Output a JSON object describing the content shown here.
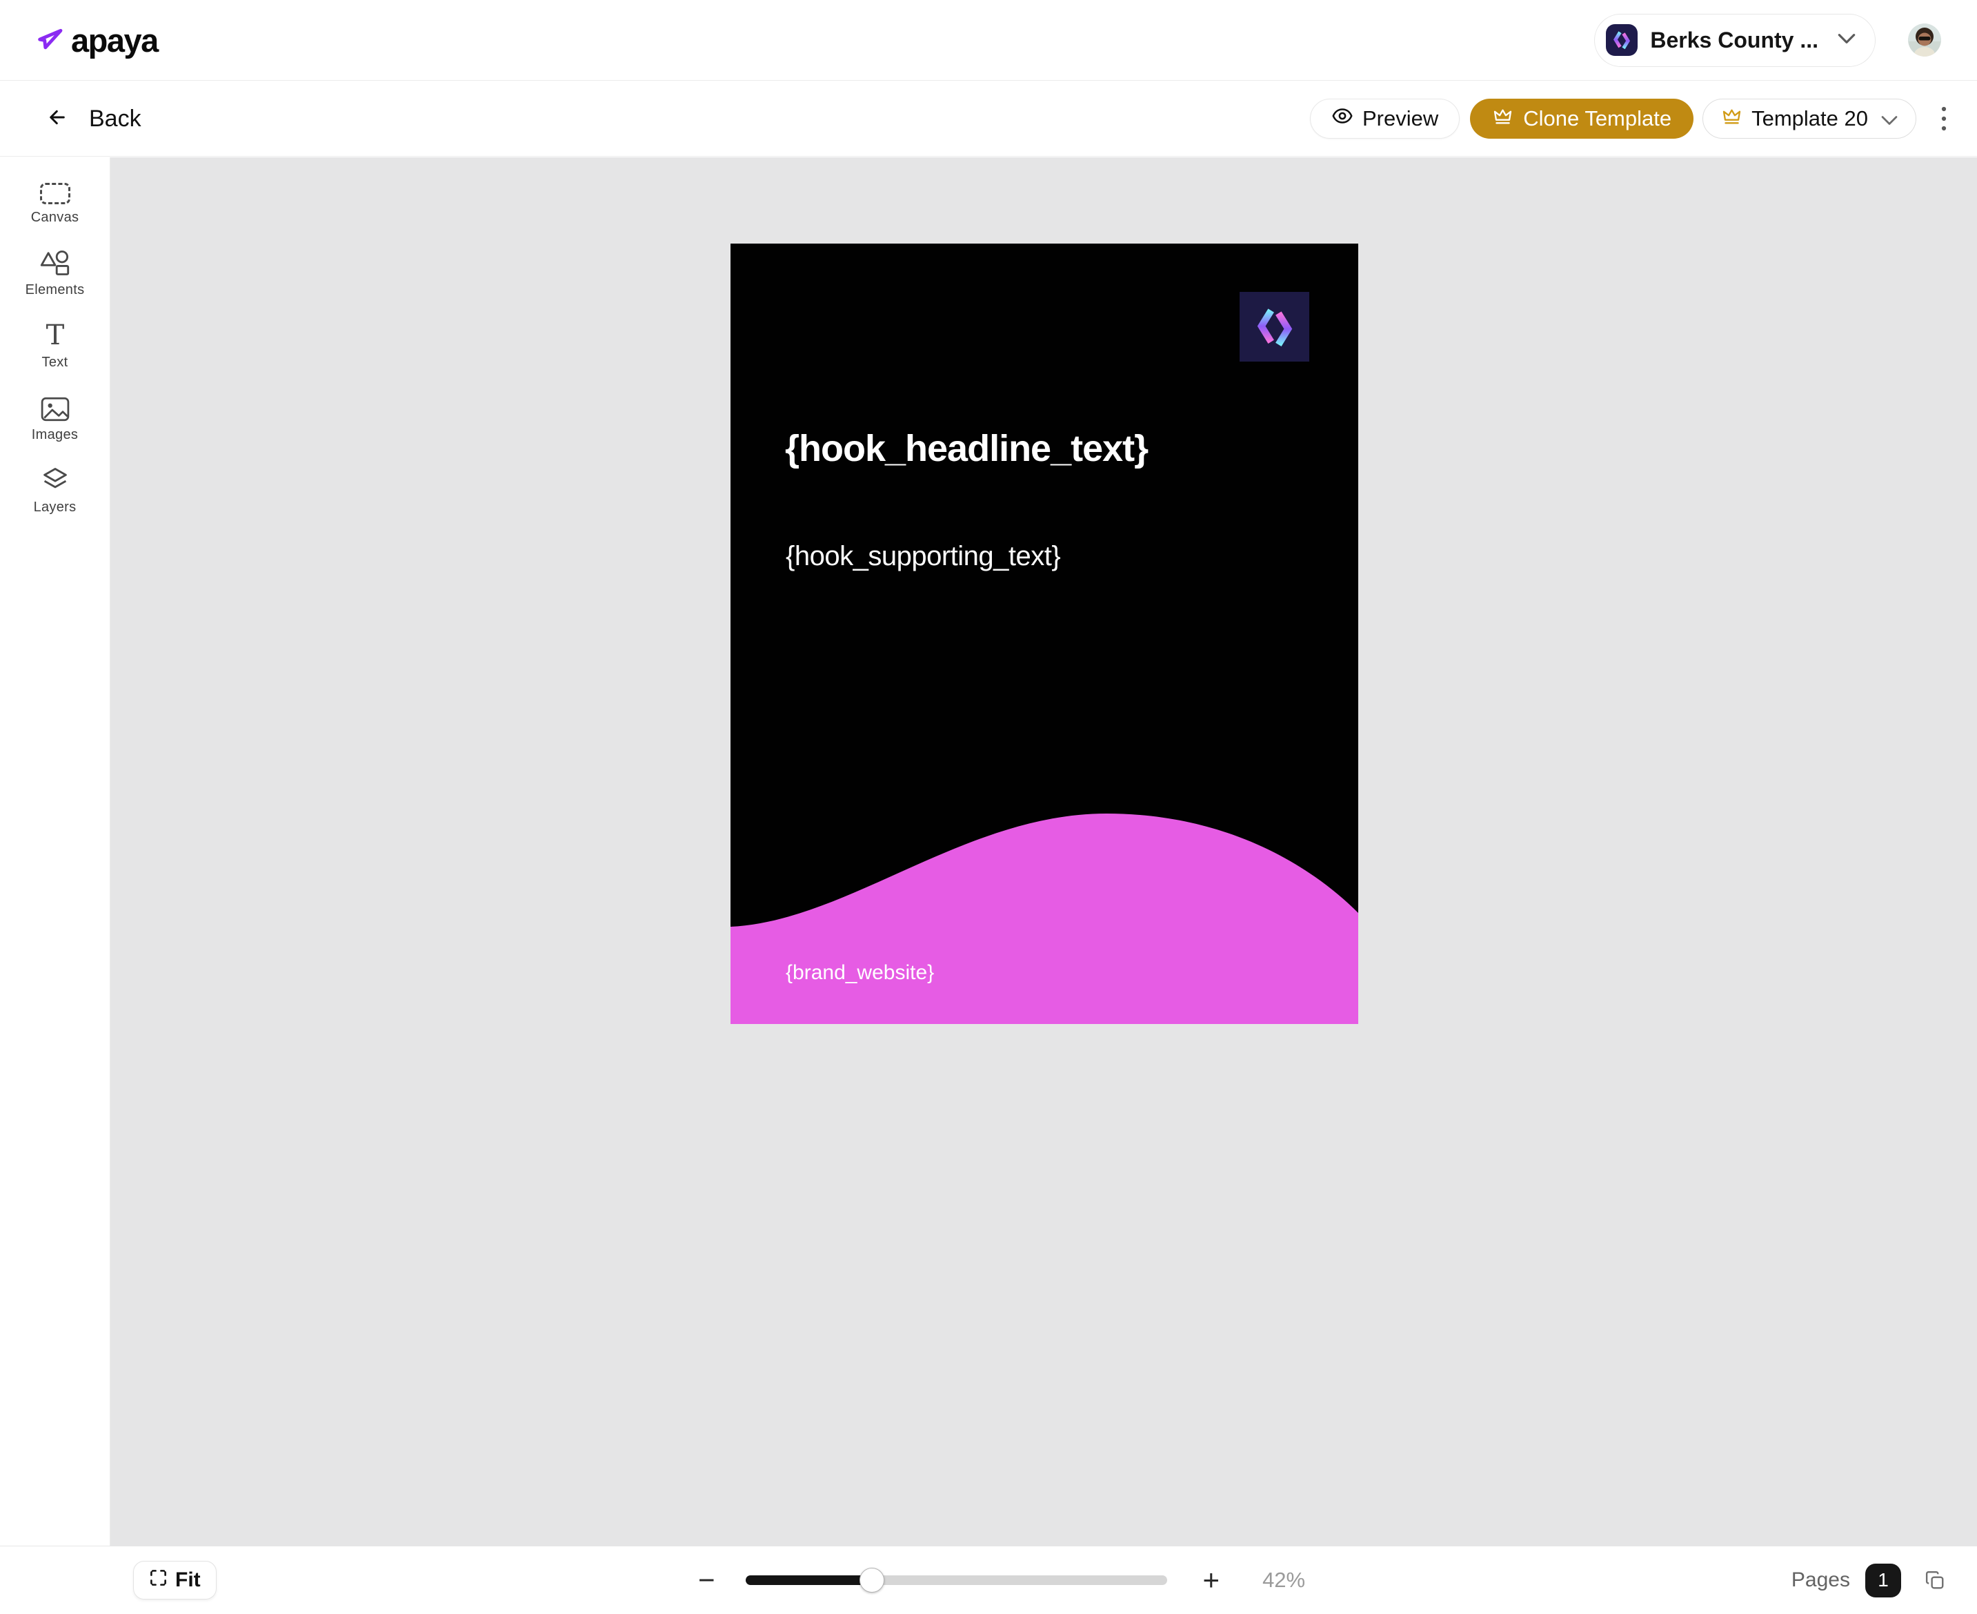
{
  "header": {
    "brand": "apaya",
    "workspace": "Berks County ..."
  },
  "toolbar": {
    "back_label": "Back",
    "preview_label": "Preview",
    "clone_label": "Clone Template",
    "template_label": "Template 20"
  },
  "sidebar": {
    "items": [
      {
        "label": "Canvas"
      },
      {
        "label": "Elements"
      },
      {
        "label": "Text"
      },
      {
        "label": "Images"
      },
      {
        "label": "Layers"
      }
    ]
  },
  "card": {
    "headline": "{hook_headline_text}",
    "supporting": "{hook_supporting_text}",
    "website": "{brand_website}"
  },
  "bottombar": {
    "fit_label": "Fit",
    "zoom_out": "−",
    "zoom_in": "+",
    "zoom_pct": "42%",
    "pages_label": "Pages",
    "page_count": "1"
  },
  "colors": {
    "accent_gold": "#c08a12",
    "wave_pink": "#e65ce4",
    "brand_purple": "#8b2bf2",
    "logo_navy": "#1e1b4b",
    "logo_cyan": "#79edfa",
    "logo_magenta": "#f473de",
    "canvas_gray": "#e5e5e6",
    "card_black": "#010101"
  }
}
